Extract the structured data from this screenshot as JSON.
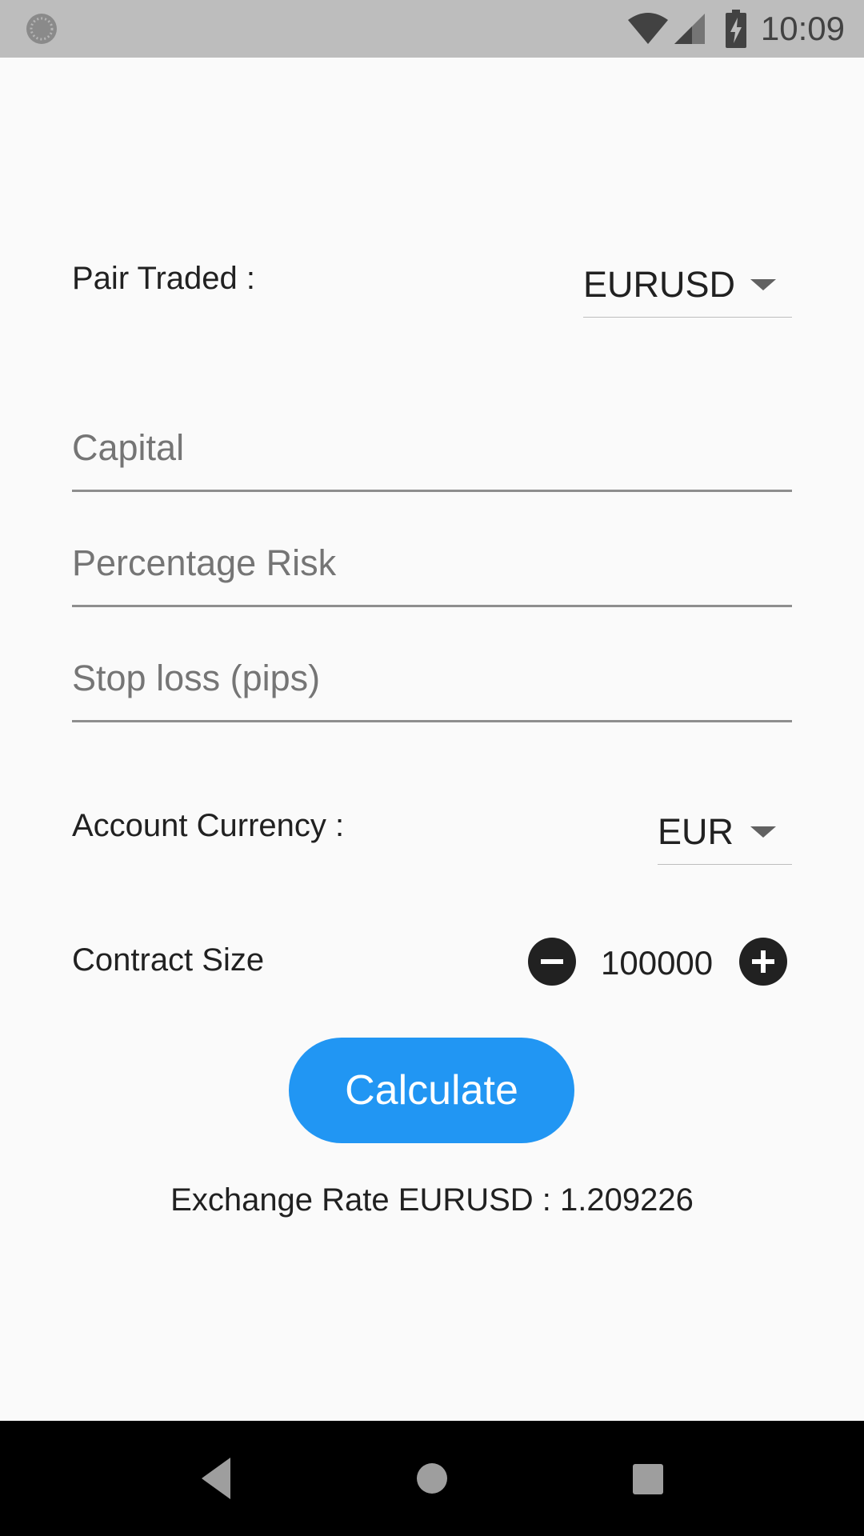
{
  "status_bar": {
    "time": "10:09",
    "icons": [
      "loading-icon",
      "wifi-icon",
      "cell-signal-icon",
      "battery-charging-icon"
    ]
  },
  "form": {
    "pair_traded": {
      "label": "Pair Traded :",
      "selected": "EURUSD"
    },
    "capital": {
      "placeholder": "Capital",
      "value": ""
    },
    "percentage_risk": {
      "placeholder": "Percentage Risk",
      "value": ""
    },
    "stop_loss": {
      "placeholder": "Stop loss (pips)",
      "value": ""
    },
    "account_currency": {
      "label": "Account Currency :",
      "selected": "EUR"
    },
    "contract_size": {
      "label": "Contract Size",
      "value": "100000"
    },
    "calculate_label": "Calculate",
    "exchange_rate_text": "Exchange Rate EURUSD : 1.209226"
  },
  "nav_bar": {
    "icons": [
      "back-icon",
      "home-icon",
      "recents-icon"
    ]
  },
  "colors": {
    "accent": "#2196f3",
    "status_bar_bg": "#bdbdbd",
    "background": "#fafafa",
    "nav_bar_bg": "#000000"
  }
}
